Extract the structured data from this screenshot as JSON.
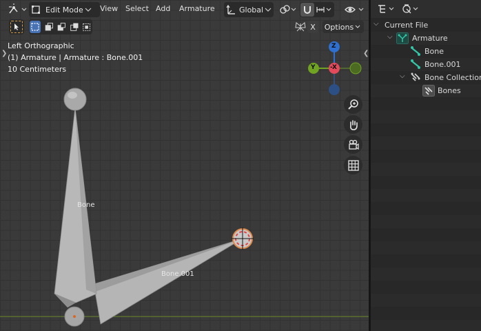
{
  "header": {
    "mode": "Edit Mode",
    "menus": [
      "View",
      "Select",
      "Add",
      "Armature"
    ],
    "orientation": "Global"
  },
  "toolbar": {
    "options_label": "Options",
    "x_mirror_label": "X"
  },
  "viewport": {
    "view_name": "Left Orthographic",
    "object_info": "(1) Armature | Armature : Bone.001",
    "scale_info": "10 Centimeters",
    "bone_labels": [
      "Bone",
      "Bone.001"
    ]
  },
  "gizmo": {
    "axes": [
      "Z",
      "Y",
      "-X"
    ],
    "colors": {
      "z": "#2f6fcf",
      "y": "#6fa321",
      "x": "#e34b5c"
    }
  },
  "outliner": {
    "rows": [
      {
        "label": "Current File",
        "icon": "chevron-down-icon"
      },
      {
        "label": "Armature",
        "icon": "armature-icon"
      },
      {
        "label": "Bone",
        "icon": "bone-icon"
      },
      {
        "label": "Bone.001",
        "icon": "bone-icon"
      },
      {
        "label": "Bone Collections",
        "icon": "bone-collections-icon"
      },
      {
        "label": "Bones",
        "icon": "bone-collection-icon"
      }
    ]
  },
  "colors": {
    "accent": "#4772b3",
    "bone_fill": "#b5b5b5",
    "horizon": "#6a8a2a"
  }
}
